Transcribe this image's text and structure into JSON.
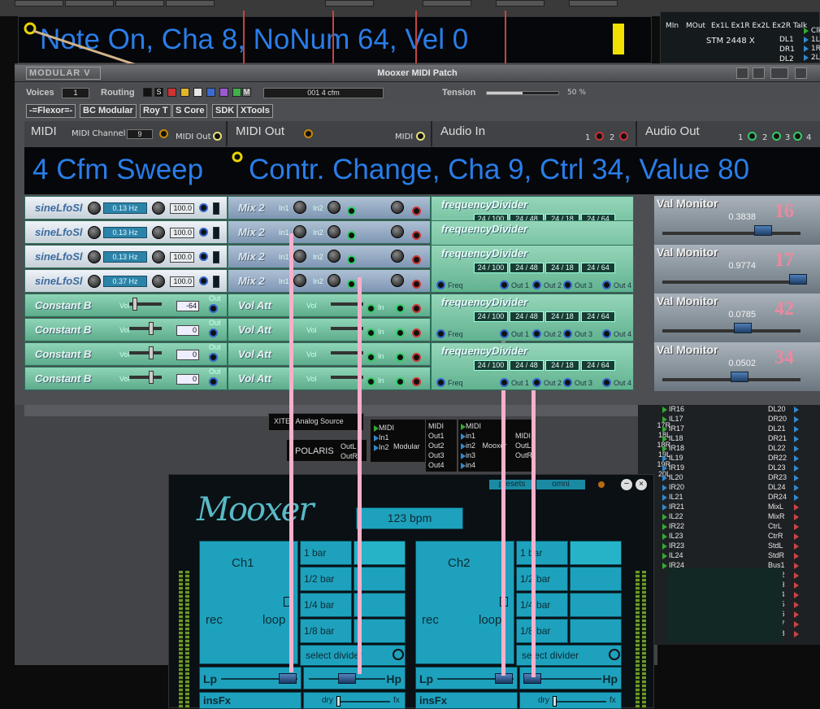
{
  "top_display": {
    "text": "Note On, Cha 8, NoNum 64, Vel 0"
  },
  "stm_panel": {
    "tabs": [
      "MIn",
      "MOut",
      "Ex1L",
      "Ex1R",
      "Ex2L",
      "Ex2R",
      "Talk"
    ],
    "device": "STM 2448 X",
    "outs_left": [
      "DL1",
      "DR1",
      "DL2"
    ],
    "outs_right": [
      "Clk",
      "1L",
      "1R",
      "2L"
    ]
  },
  "window": {
    "logo": "MODULAR V",
    "title": "Mooxer MIDI Patch"
  },
  "controls": {
    "voices_label": "Voices",
    "voices_value": "1",
    "routing_label": "Routing",
    "routing_s": "S",
    "routing_m": "M",
    "patch_name": "001 4 cfm",
    "tension_label": "Tension",
    "tension_value": "50 %",
    "tension_level": 0.5
  },
  "plugin_buttons": [
    "-=Flexor=-",
    "BC Modular",
    "Roy T",
    "S Core",
    "SDK",
    "XTools"
  ],
  "headers": {
    "midi": "MIDI",
    "midi_channel_label": "MIDI Channel",
    "midi_channel": "9",
    "midi_out_label": "MIDI Out",
    "midi_out": "MIDI Out",
    "midi_small": "MIDI",
    "audio_in": "Audio In",
    "audio_in_ports": [
      "1",
      "2"
    ],
    "audio_out": "Audio Out",
    "audio_out_ports": [
      "1",
      "2",
      "3",
      "4"
    ]
  },
  "banner": {
    "left": "4 Cfm Sweep",
    "right": "Contr. Change, Cha 9, Ctrl 34, Value 80"
  },
  "rows": [
    {
      "left": "sineLfoSl",
      "hz": "0.13 Hz",
      "amt": "100.0",
      "mid": "Mix 2",
      "right": "frequencyDivider",
      "divs": [
        "24 / 100",
        "24 / 48",
        "24 / 18",
        "24 / 64"
      ]
    },
    {
      "left": "sineLfoSl",
      "hz": "0.13 Hz",
      "amt": "100.0",
      "mid": "Mix 2",
      "right": "frequencyDivider",
      "divs": []
    },
    {
      "left": "sineLfoSl",
      "hz": "0.13 Hz",
      "amt": "100.0",
      "mid": "Mix 2",
      "right": "frequencyDivider",
      "divs": [
        "24 / 100",
        "24 / 48",
        "24 / 18",
        "24 / 64"
      ]
    },
    {
      "left": "sineLfoSl",
      "hz": "0.37 Hz",
      "amt": "100.0",
      "mid": "Mix 2",
      "right": "",
      "divs": []
    },
    {
      "left": "Constant B",
      "val": "-64",
      "mid": "Vol Att",
      "right": "frequencyDivider",
      "divs": [
        "24 / 100",
        "24 / 48",
        "24 / 18",
        "24 / 64"
      ]
    },
    {
      "left": "Constant B",
      "val": "0",
      "mid": "Vol Att",
      "right": "",
      "divs": []
    },
    {
      "left": "Constant B",
      "val": "0",
      "mid": "Vol Att",
      "right": "frequencyDivider",
      "divs": [
        "24 / 100",
        "24 / 48",
        "24 / 18",
        "24 / 64"
      ]
    },
    {
      "left": "Constant B",
      "val": "0",
      "mid": "Vol Att",
      "right": "",
      "divs": []
    }
  ],
  "module_labels": {
    "in1": "In1",
    "in2": "In2",
    "in": "In",
    "out": "Out",
    "vol": "Vol",
    "freq": "Freq",
    "out1": "Out 1",
    "out2": "Out 2",
    "out3": "Out 3",
    "out4": "Out 4"
  },
  "val_monitors": [
    {
      "title": "Val Monitor",
      "value": "0.3838",
      "index": "16",
      "level": 0.73
    },
    {
      "title": "Val Monitor",
      "value": "0.9774",
      "index": "17",
      "level": 0.98
    },
    {
      "title": "Val Monitor",
      "value": "0.0785",
      "index": "42",
      "level": 0.58
    },
    {
      "title": "Val Monitor",
      "value": "0.0502",
      "index": "34",
      "level": 0.56
    }
  ],
  "sources": {
    "analog_source": "Analog Source",
    "xite": "XITE",
    "polaris": "POLARIS",
    "out_l": "OutL",
    "out_r": "OutR",
    "modular_label": "Modular",
    "modular_ins": [
      "MIDI",
      "In1",
      "In2"
    ],
    "modular_outs": [
      "MIDI",
      "Out1",
      "Out2",
      "Out3",
      "Out4"
    ],
    "mooxer_label": "Mooxer",
    "mooxer_ins": [
      "MIDI",
      "in1",
      "in2",
      "in3",
      "in4"
    ],
    "mooxer_outs": [
      "MIDI",
      "OutL",
      "OutR"
    ]
  },
  "right_list": {
    "inputs": [
      "17R",
      "18L",
      "18R",
      "19L",
      "19R",
      "20L"
    ],
    "ir": [
      "IR16",
      "IL17",
      "IR17",
      "IL18",
      "IR18",
      "IL19",
      "IR19",
      "IL20",
      "IR20",
      "IL21",
      "IR21",
      "IL22",
      "IR22",
      "IL23",
      "IR23",
      "IL24",
      "IR24"
    ],
    "dl": [
      "DL20",
      "DR20",
      "DL21",
      "DR21",
      "DL22",
      "DR22",
      "DL23",
      "DR23",
      "DL24",
      "DR24",
      "MixL",
      "MixR",
      "CtrL",
      "CtrR",
      "StdL",
      "StdR",
      "Bus1",
      "Bus2",
      "Bus3",
      "Bus4",
      "Bus5",
      "Bus6",
      "Bus7",
      "Bus8"
    ]
  },
  "mooxer": {
    "presets": "presets",
    "omni": "omni",
    "bpm": "123 bpm",
    "ch1": "Ch1",
    "ch2": "Ch2",
    "rec": "rec",
    "loop": "loop",
    "divs": [
      "1 bar",
      "1/2 bar",
      "1/4 bar",
      "1/8 bar"
    ],
    "select_divider": "select divider",
    "lp": "Lp",
    "hp": "Hp",
    "insfx": "insFx",
    "dry": "dry",
    "fx": "fx",
    "ch1_lp_level": 0.87,
    "ch1_hp_level": 0.5,
    "ch2_lp_level": 0.87,
    "ch2_hp_level": 0.1
  },
  "colors": {
    "display_text": "#2a7de8",
    "cable": "#f7b0ca",
    "mooxer_panel": "#1ea1bd",
    "monitor_number": "#e98aa0"
  }
}
